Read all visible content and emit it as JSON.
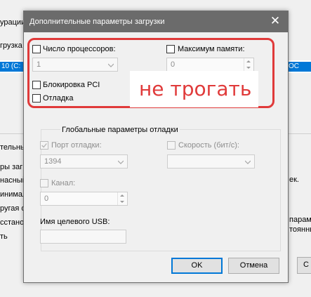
{
  "background": {
    "title_fragment": "урации",
    "tab_fragment": "грузка",
    "list_left": "10 (C:",
    "list_right": "ОС",
    "side_fragments": [
      "тельные",
      "ры загр",
      "насный",
      "инимал",
      "ругая о",
      "сстано",
      "ть"
    ],
    "right_fragments": [
      "ек.",
      "парам",
      "тоянны"
    ],
    "partial_button": "С"
  },
  "dialog": {
    "title": "Дополнительные параметры загрузки",
    "close_glyph": "✕",
    "cpu_count": {
      "label": "Число процессоров:",
      "checked": false,
      "value": "1"
    },
    "max_memory": {
      "label": "Максимум памяти:",
      "checked": false,
      "value": "0"
    },
    "pci_lock": {
      "label": "Блокировка PCI",
      "checked": false
    },
    "debug": {
      "label": "Отладка",
      "checked": false
    },
    "global_debug": {
      "title": "Глобальные параметры отладки",
      "debug_port": {
        "label": "Порт отладки:",
        "checked": true,
        "value": "1394"
      },
      "baud_rate": {
        "label": "Скорость (бит/с):",
        "checked": false,
        "value": ""
      },
      "channel": {
        "label": "Канал:",
        "checked": false,
        "value": "0"
      },
      "usb_target": {
        "label": "Имя целевого USB:",
        "value": ""
      }
    },
    "ok_label": "OK",
    "cancel_label": "Отмена"
  },
  "annotation": {
    "text": "не трогать",
    "color": "#e03a3a"
  }
}
